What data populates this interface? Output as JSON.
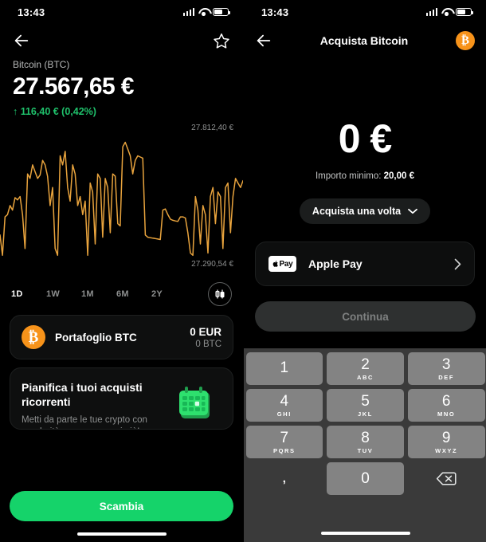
{
  "statusbar": {
    "time": "13:43",
    "battery_level": 62
  },
  "left": {
    "nav": {
      "back_icon": "arrow-left-icon",
      "favorite_icon": "star-icon"
    },
    "asset": {
      "name": "Bitcoin (BTC)",
      "price": "27.567,65 €",
      "change": "↑ 116,40 € (0,42%)",
      "change_color": "#1fc16b"
    },
    "chart": {
      "high_label": "27.812,40 €",
      "low_label": "27.290,54 €",
      "line_color": "#e8a33d"
    },
    "ranges": [
      {
        "label": "1D",
        "active": true
      },
      {
        "label": "1W",
        "active": false
      },
      {
        "label": "1M",
        "active": false
      },
      {
        "label": "6M",
        "active": false
      },
      {
        "label": "2Y",
        "active": false
      }
    ],
    "candle_toggle_icon": "candlestick-icon",
    "wallet": {
      "icon": "bitcoin-coin-icon",
      "label": "Portafoglio BTC",
      "fiat": "0 EUR",
      "crypto": "0 BTC"
    },
    "promo": {
      "title": "Pianifica i tuoi acquisti ricorrenti",
      "subtitle": "Metti da parte le tue crypto con regolarità e non pensarci più!",
      "art_icon": "calendar-icon",
      "art_color": "#22c55e"
    },
    "cta": {
      "label": "Scambia",
      "color": "#15d36a"
    }
  },
  "right": {
    "nav": {
      "back_icon": "arrow-left-icon",
      "title": "Acquista Bitcoin",
      "avatar_icon": "bitcoin-avatar-icon"
    },
    "amount": {
      "value": "0 €"
    },
    "minimum": {
      "prefix": "Importo minimo: ",
      "value": "20,00 €"
    },
    "frequency": {
      "label": "Acquista una volta",
      "chevron_icon": "chevron-down-icon"
    },
    "payment": {
      "badge_text": "Pay",
      "apple_icon": "apple-logo-icon",
      "label": "Apple Pay",
      "chevron_icon": "chevron-right-icon"
    },
    "continue": {
      "label": "Continua",
      "enabled": false
    },
    "keypad": {
      "rows": [
        [
          {
            "num": "1",
            "sub": ""
          },
          {
            "num": "2",
            "sub": "ABC"
          },
          {
            "num": "3",
            "sub": "DEF"
          }
        ],
        [
          {
            "num": "4",
            "sub": "GHI"
          },
          {
            "num": "5",
            "sub": "JKL"
          },
          {
            "num": "6",
            "sub": "MNO"
          }
        ],
        [
          {
            "num": "7",
            "sub": "PQRS"
          },
          {
            "num": "8",
            "sub": "TUV"
          },
          {
            "num": "9",
            "sub": "WXYZ"
          }
        ]
      ],
      "comma": ",",
      "zero": "0",
      "backspace_icon": "backspace-icon"
    }
  },
  "chart_data": {
    "type": "line",
    "title": "Bitcoin (BTC) 1D",
    "ylabel": "EUR",
    "ylim": [
      27290.54,
      27812.4
    ],
    "high_label": "27.812,40 €",
    "low_label": "27.290,54 €",
    "line_color": "#e8a33d",
    "grid": false,
    "legend": "none",
    "values": [
      27390,
      27300,
      27470,
      27480,
      27520,
      27500,
      27555,
      27545,
      27560,
      27480,
      27330,
      27660,
      27640,
      27700,
      27670,
      27640,
      27655,
      27720,
      27700,
      27650,
      27520,
      27600,
      27330,
      27300,
      27740,
      27700,
      27760,
      27600,
      27540,
      27700,
      27660,
      27520,
      27560,
      27480,
      27540,
      27300,
      27620,
      27580,
      27350,
      27660,
      27640,
      27380,
      27640,
      27600,
      27400,
      27660,
      27650,
      27440,
      27430,
      27780,
      27800,
      27770,
      27740,
      27660,
      27720,
      27740,
      27735,
      27730,
      27390,
      27380,
      27378,
      27376,
      27374,
      27372,
      27370,
      27500,
      27505,
      27480,
      27460,
      27455,
      27452,
      27450,
      27470,
      27470,
      27465,
      27400,
      27310,
      27300,
      27560,
      27500,
      27350,
      27520,
      27480,
      27310,
      27560,
      27600,
      27440,
      27580,
      27560,
      27330,
      27600,
      27620,
      27400,
      27560,
      27640,
      27620,
      27600,
      27630
    ]
  }
}
